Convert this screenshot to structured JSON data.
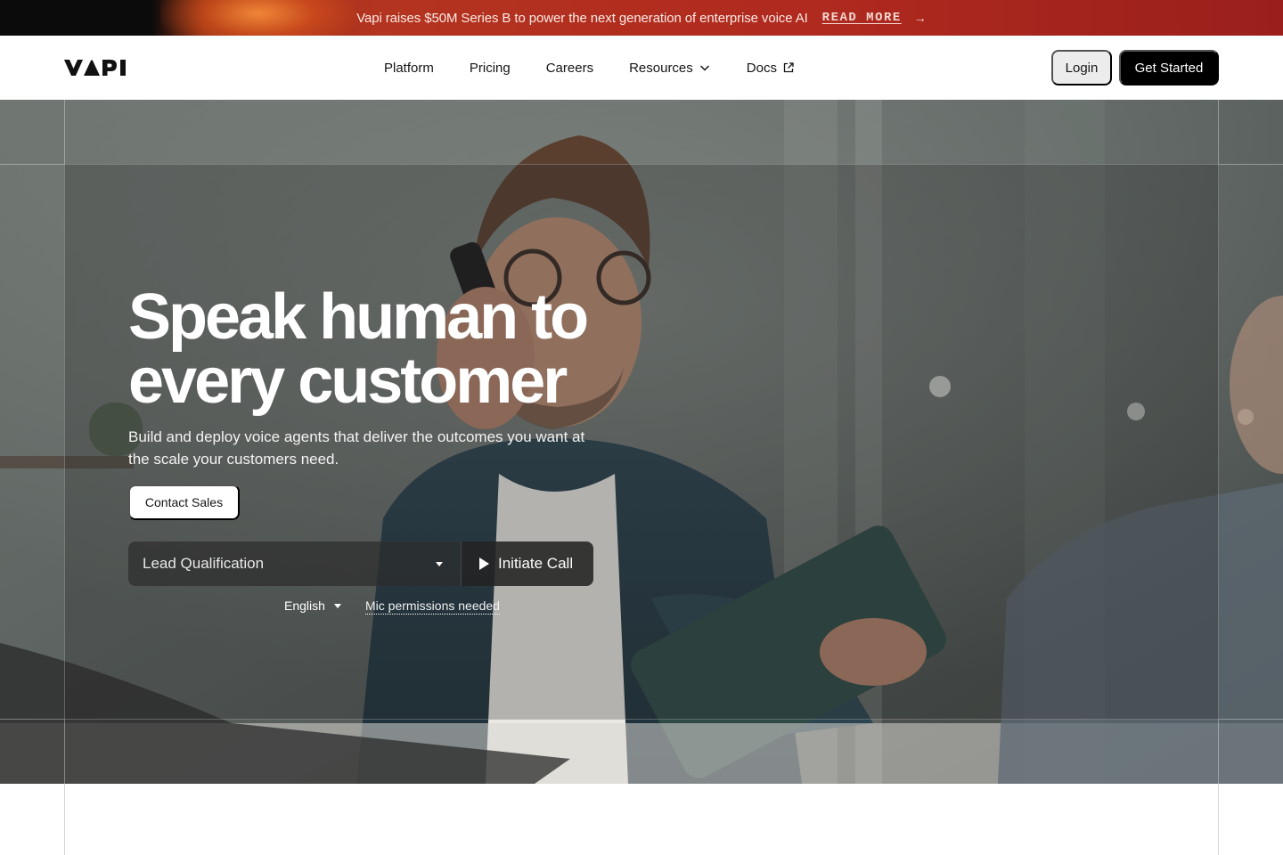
{
  "banner": {
    "text": "Vapi raises $50M Series B to power the next generation of enterprise voice AI",
    "link_label": "READ MORE",
    "arrow": "→"
  },
  "header": {
    "logo_text": "VAPI",
    "nav": [
      {
        "label": "Platform"
      },
      {
        "label": "Pricing"
      },
      {
        "label": "Careers"
      },
      {
        "label": "Resources",
        "icon": "chevron-down-icon"
      },
      {
        "label": "Docs",
        "icon": "external-link-icon"
      }
    ],
    "login_label": "Login",
    "get_started_label": "Get Started"
  },
  "hero": {
    "headline_line1": "Speak human to",
    "headline_line2": "every customer",
    "subheadline": "Build and deploy voice agents that deliver the outcomes you want at the scale your customers need.",
    "contact_label": "Contact Sales",
    "agent_select_value": "Lead Qualification",
    "initiate_label": "Initiate Call",
    "language_value": "English",
    "mic_notice": "Mic permissions needed"
  },
  "colors": {
    "banner_red": "#b02a1f",
    "primary_black": "#000000",
    "login_bg": "#ececec"
  }
}
